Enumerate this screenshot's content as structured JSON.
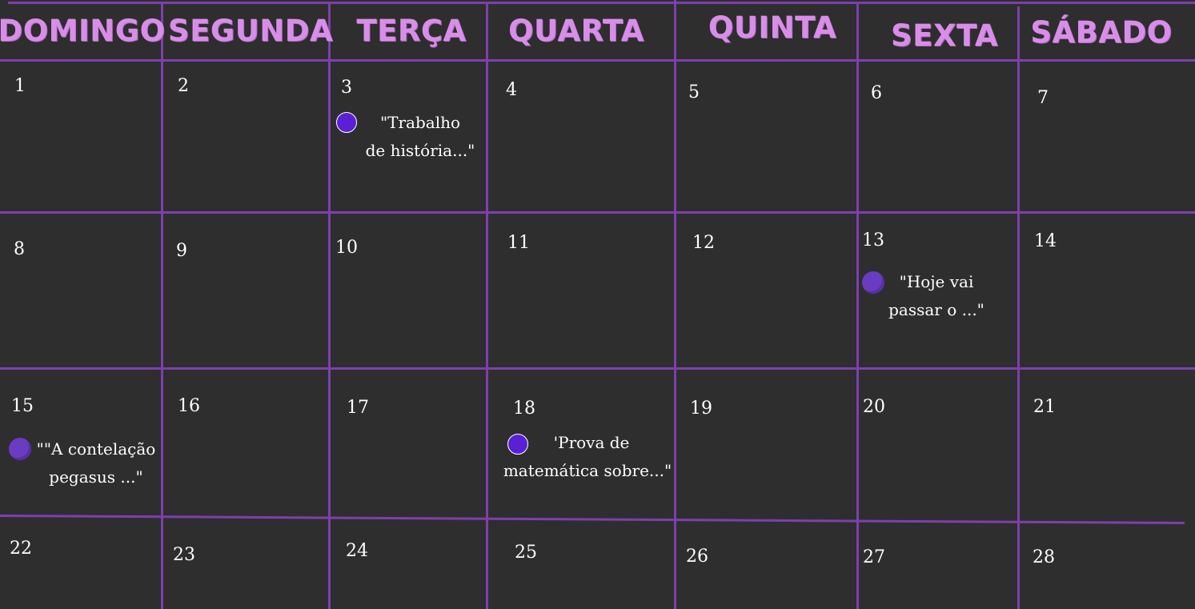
{
  "weekdays": [
    "DOMINGO",
    "SEGUNDA",
    "TERÇA",
    "QUARTA",
    "QUINTA",
    "SEXTA",
    "SÁBADO"
  ],
  "days": [
    "1",
    "2",
    "3",
    "4",
    "5",
    "6",
    "7",
    "8",
    "9",
    "10",
    "11",
    "12",
    "13",
    "14",
    "15",
    "16",
    "17",
    "18",
    "19",
    "20",
    "21",
    "22",
    "23",
    "24",
    "25",
    "26",
    "27",
    "28"
  ],
  "events": {
    "day3": {
      "line1": "\"Trabalho",
      "line2": "de história...\""
    },
    "day13": {
      "line1": "\"Hoje vai",
      "line2": "passar o ...\""
    },
    "day15": {
      "line1": "\"\"A contelação",
      "line2": "pegasus ...\""
    },
    "day18": {
      "line1": "'Prova de",
      "line2": "matemática sobre...\""
    }
  },
  "colors": {
    "background": "#2e2e2e",
    "grid": "#7e3fae",
    "header_text": "#d88ee8",
    "event_dot": "#5b1fd6"
  },
  "icons": {
    "event_marker": "purple-dot-icon"
  }
}
